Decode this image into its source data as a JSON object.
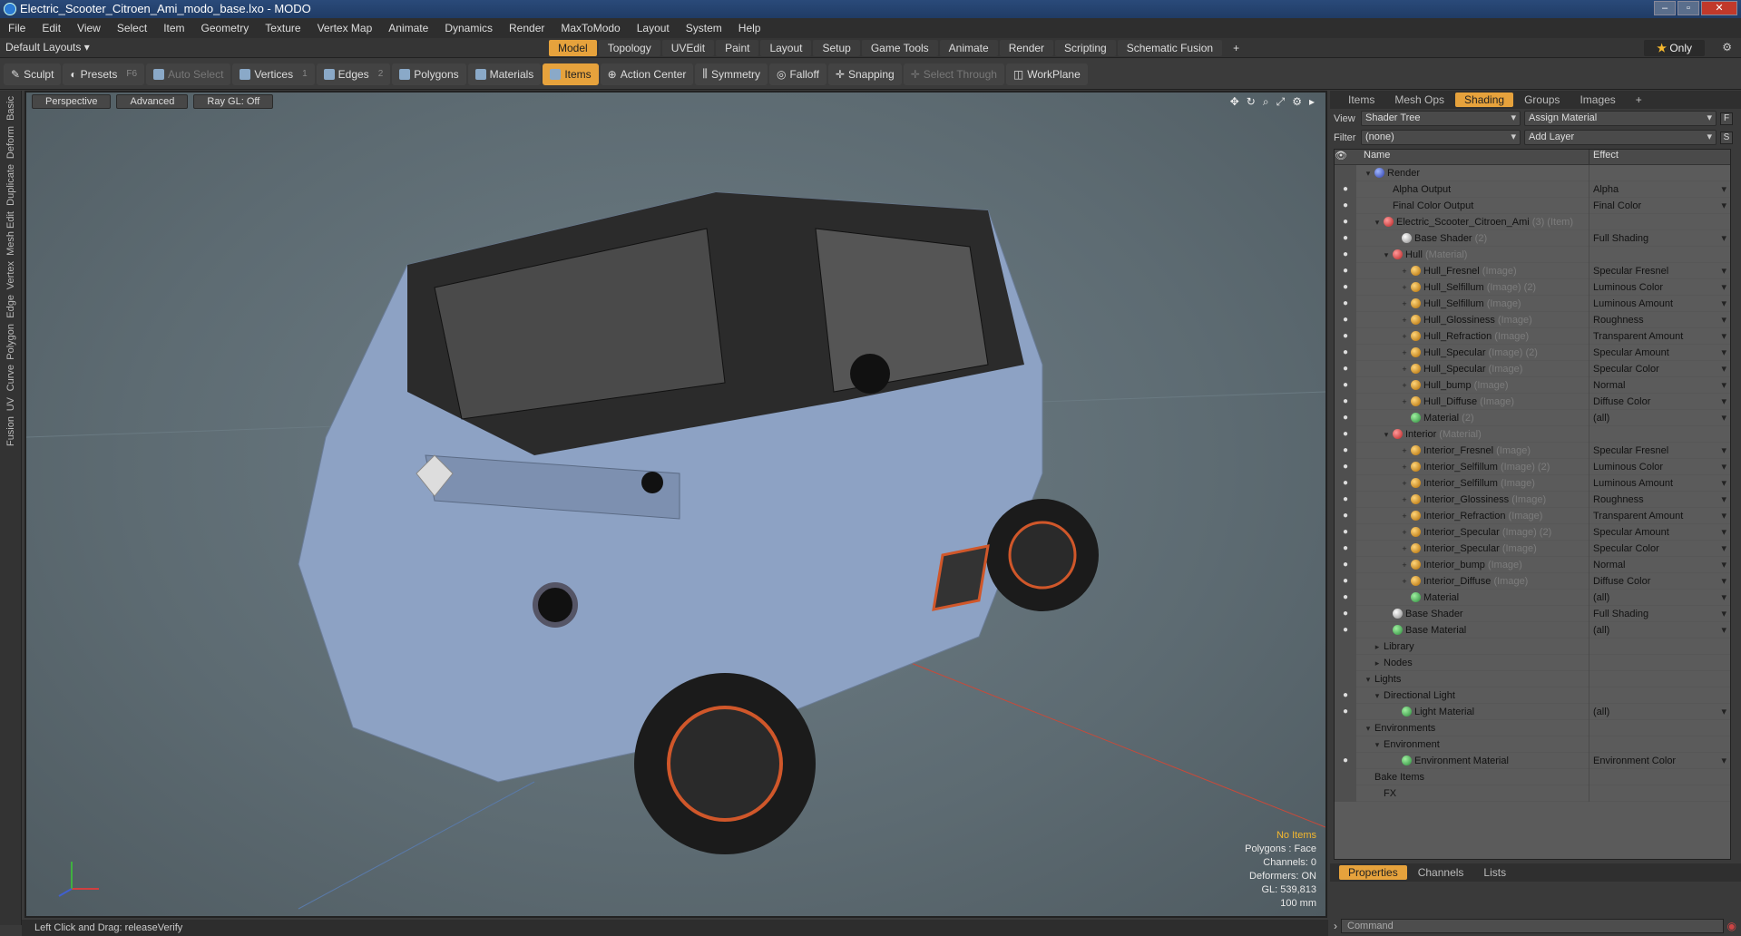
{
  "window": {
    "title": "Electric_Scooter_Citroen_Ami_modo_base.lxo - MODO"
  },
  "menu": [
    "File",
    "Edit",
    "View",
    "Select",
    "Item",
    "Geometry",
    "Texture",
    "Vertex Map",
    "Animate",
    "Dynamics",
    "Render",
    "MaxToModo",
    "Layout",
    "System",
    "Help"
  ],
  "layoutbar": {
    "default_layouts": "Default Layouts ▾",
    "tabs": [
      "Model",
      "Topology",
      "UVEdit",
      "Paint",
      "Layout",
      "Setup",
      "Game Tools",
      "Animate",
      "Render",
      "Scripting",
      "Schematic Fusion"
    ],
    "active_tab": "Model",
    "only": "Only"
  },
  "toolbar": {
    "sculpt": "Sculpt",
    "presets": "Presets",
    "presets_key": "F6",
    "auto_select": "Auto Select",
    "vertices": "Vertices",
    "vertices_key": "1",
    "edges": "Edges",
    "edges_key": "2",
    "polygons": "Polygons",
    "materials": "Materials",
    "items": "Items",
    "action_center": "Action Center",
    "symmetry": "Symmetry",
    "falloff": "Falloff",
    "snapping": "Snapping",
    "select_through": "Select Through",
    "workplane": "WorkPlane"
  },
  "leftstrip": [
    "Basic",
    "Deform",
    "Duplicate",
    "Mesh Edit",
    "Vertex",
    "Edge",
    "Polygon",
    "Curve",
    "UV",
    "Fusion"
  ],
  "viewport": {
    "perspective": "Perspective",
    "advanced": "Advanced",
    "raygl": "Ray GL: Off",
    "stats": {
      "no_items": "No Items",
      "polygons": "Polygons : Face",
      "channels": "Channels: 0",
      "deformers": "Deformers: ON",
      "gl": "GL: 539,813",
      "scale": "100 mm"
    }
  },
  "statusbar": {
    "text": "Left Click and Drag:  releaseVerify"
  },
  "rpanel": {
    "tabs": [
      "Items",
      "Mesh Ops",
      "Shading",
      "Groups",
      "Images"
    ],
    "active_tab": "Shading",
    "view_label": "View",
    "view_value": "Shader Tree",
    "assign_material": "Assign Material",
    "filter_label": "Filter",
    "filter_value": "(none)",
    "add_layer": "Add Layer",
    "col_name": "Name",
    "col_effect": "Effect",
    "rows": [
      {
        "name": "Render",
        "sub": "",
        "effect": "",
        "indent": 0,
        "tri": "▾",
        "icon": "blue",
        "eye": false
      },
      {
        "name": "Alpha Output",
        "sub": "",
        "effect": "Alpha",
        "indent": 2,
        "tri": "",
        "icon": "",
        "eye": true
      },
      {
        "name": "Final Color Output",
        "sub": "",
        "effect": "Final Color",
        "indent": 2,
        "tri": "",
        "icon": "",
        "eye": true
      },
      {
        "name": "Electric_Scooter_Citroen_Ami",
        "sub": " (3) (Item)",
        "effect": "",
        "indent": 1,
        "tri": "▾",
        "icon": "red",
        "eye": true
      },
      {
        "name": "Base Shader",
        "sub": " (2)",
        "effect": "Full Shading",
        "indent": 3,
        "tri": "",
        "icon": "wht",
        "eye": true
      },
      {
        "name": "Hull",
        "sub": " (Material)",
        "effect": "",
        "indent": 2,
        "tri": "▾",
        "icon": "red",
        "eye": true
      },
      {
        "name": "Hull_Fresnel",
        "sub": " (Image)",
        "effect": "Specular Fresnel",
        "indent": 4,
        "tri": "+",
        "icon": "img",
        "eye": true
      },
      {
        "name": "Hull_Selfillum",
        "sub": " (Image) (2)",
        "effect": "Luminous Color",
        "indent": 4,
        "tri": "+",
        "icon": "img",
        "eye": true
      },
      {
        "name": "Hull_Selfillum",
        "sub": " (Image)",
        "effect": "Luminous Amount",
        "indent": 4,
        "tri": "+",
        "icon": "img",
        "eye": true
      },
      {
        "name": "Hull_Glossiness",
        "sub": " (Image)",
        "effect": "Roughness",
        "indent": 4,
        "tri": "+",
        "icon": "img",
        "eye": true
      },
      {
        "name": "Hull_Refraction",
        "sub": " (Image)",
        "effect": "Transparent Amount",
        "indent": 4,
        "tri": "+",
        "icon": "img",
        "eye": true
      },
      {
        "name": "Hull_Specular",
        "sub": " (Image) (2)",
        "effect": "Specular Amount",
        "indent": 4,
        "tri": "+",
        "icon": "img",
        "eye": true
      },
      {
        "name": "Hull_Specular",
        "sub": " (Image)",
        "effect": "Specular Color",
        "indent": 4,
        "tri": "+",
        "icon": "img",
        "eye": true
      },
      {
        "name": "Hull_bump",
        "sub": " (Image)",
        "effect": "Normal",
        "indent": 4,
        "tri": "+",
        "icon": "img",
        "eye": true
      },
      {
        "name": "Hull_Diffuse",
        "sub": " (Image)",
        "effect": "Diffuse Color",
        "indent": 4,
        "tri": "+",
        "icon": "img",
        "eye": true
      },
      {
        "name": "Material",
        "sub": " (2)",
        "effect": "(all)",
        "indent": 4,
        "tri": "",
        "icon": "mat",
        "eye": true
      },
      {
        "name": "Interior",
        "sub": " (Material)",
        "effect": "",
        "indent": 2,
        "tri": "▾",
        "icon": "red",
        "eye": true
      },
      {
        "name": "Interior_Fresnel",
        "sub": " (Image)",
        "effect": "Specular Fresnel",
        "indent": 4,
        "tri": "+",
        "icon": "img",
        "eye": true
      },
      {
        "name": "Interior_Selfillum",
        "sub": " (Image) (2)",
        "effect": "Luminous Color",
        "indent": 4,
        "tri": "+",
        "icon": "img",
        "eye": true
      },
      {
        "name": "Interior_Selfillum",
        "sub": " (Image)",
        "effect": "Luminous Amount",
        "indent": 4,
        "tri": "+",
        "icon": "img",
        "eye": true
      },
      {
        "name": "Interior_Glossiness",
        "sub": " (Image)",
        "effect": "Roughness",
        "indent": 4,
        "tri": "+",
        "icon": "img",
        "eye": true
      },
      {
        "name": "Interior_Refraction",
        "sub": " (Image)",
        "effect": "Transparent Amount",
        "indent": 4,
        "tri": "+",
        "icon": "img",
        "eye": true
      },
      {
        "name": "Interior_Specular",
        "sub": " (Image) (2)",
        "effect": "Specular Amount",
        "indent": 4,
        "tri": "+",
        "icon": "img",
        "eye": true
      },
      {
        "name": "Interior_Specular",
        "sub": " (Image)",
        "effect": "Specular Color",
        "indent": 4,
        "tri": "+",
        "icon": "img",
        "eye": true
      },
      {
        "name": "Interior_bump",
        "sub": " (Image)",
        "effect": "Normal",
        "indent": 4,
        "tri": "+",
        "icon": "img",
        "eye": true
      },
      {
        "name": "Interior_Diffuse",
        "sub": " (Image)",
        "effect": "Diffuse Color",
        "indent": 4,
        "tri": "+",
        "icon": "img",
        "eye": true
      },
      {
        "name": "Material",
        "sub": "",
        "effect": "(all)",
        "indent": 4,
        "tri": "",
        "icon": "mat",
        "eye": true
      },
      {
        "name": "Base Shader",
        "sub": "",
        "effect": "Full Shading",
        "indent": 2,
        "tri": "",
        "icon": "wht",
        "eye": true
      },
      {
        "name": "Base Material",
        "sub": "",
        "effect": "(all)",
        "indent": 2,
        "tri": "",
        "icon": "mat",
        "eye": true
      },
      {
        "name": "Library",
        "sub": "",
        "effect": "",
        "indent": 1,
        "tri": "▸",
        "icon": "",
        "eye": false
      },
      {
        "name": "Nodes",
        "sub": "",
        "effect": "",
        "indent": 1,
        "tri": "▸",
        "icon": "",
        "eye": false
      },
      {
        "name": "Lights",
        "sub": "",
        "effect": "",
        "indent": 0,
        "tri": "▾",
        "icon": "",
        "eye": false
      },
      {
        "name": "Directional Light",
        "sub": "",
        "effect": "",
        "indent": 1,
        "tri": "▾",
        "icon": "",
        "eye": true
      },
      {
        "name": "Light Material",
        "sub": "",
        "effect": "(all)",
        "indent": 3,
        "tri": "",
        "icon": "mat",
        "eye": true
      },
      {
        "name": "Environments",
        "sub": "",
        "effect": "",
        "indent": 0,
        "tri": "▾",
        "icon": "",
        "eye": false
      },
      {
        "name": "Environment",
        "sub": "",
        "effect": "",
        "indent": 1,
        "tri": "▾",
        "icon": "",
        "eye": false
      },
      {
        "name": "Environment Material",
        "sub": "",
        "effect": "Environment Color",
        "indent": 3,
        "tri": "",
        "icon": "mat",
        "eye": true
      },
      {
        "name": "Bake Items",
        "sub": "",
        "effect": "",
        "indent": 0,
        "tri": "",
        "icon": "",
        "eye": false
      },
      {
        "name": "FX",
        "sub": "",
        "effect": "",
        "indent": 1,
        "tri": "",
        "icon": "",
        "eye": false
      }
    ],
    "props_tabs": [
      "Properties",
      "Channels",
      "Lists"
    ],
    "props_active": "Properties",
    "command_placeholder": "Command"
  }
}
